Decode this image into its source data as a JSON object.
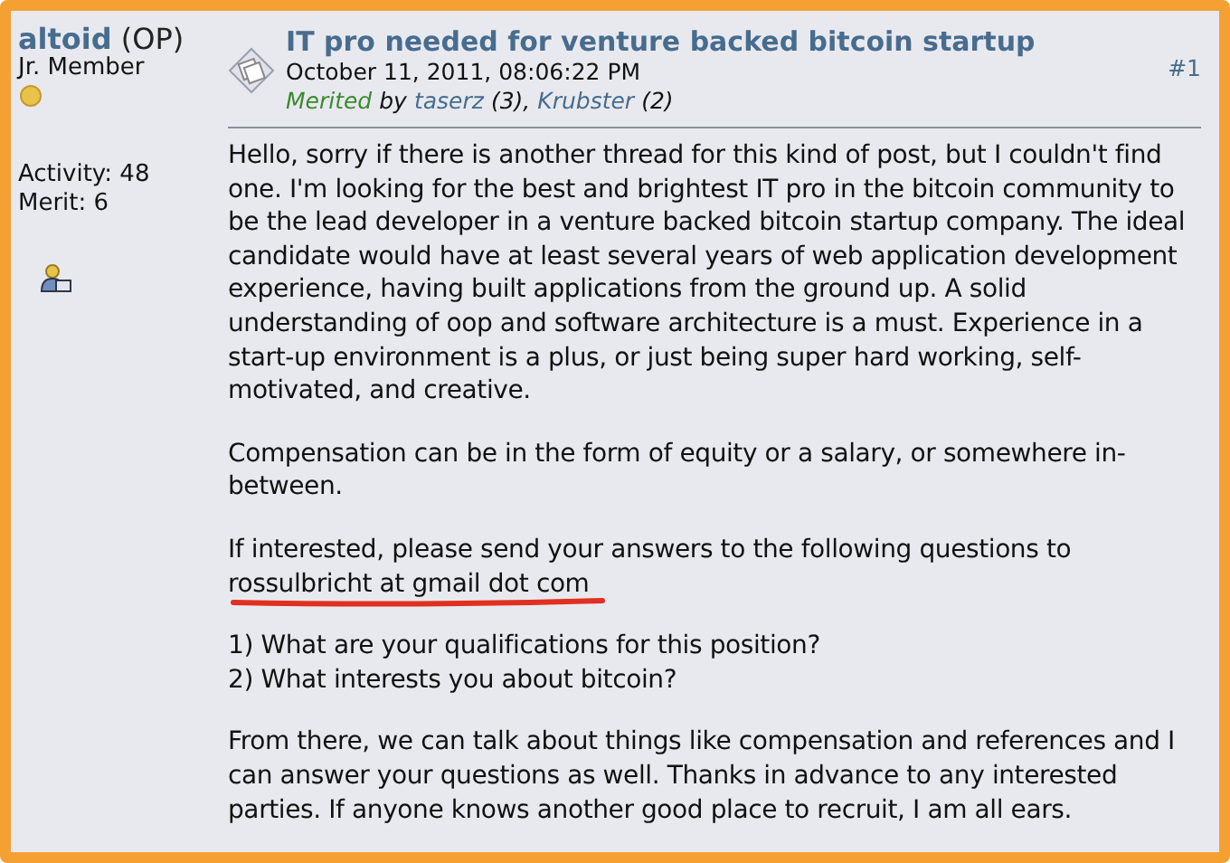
{
  "author": {
    "name": "altoid",
    "tag": "(OP)",
    "rank": "Jr. Member",
    "activity": "Activity: 48",
    "merit": "Merit: 6"
  },
  "post": {
    "title": "IT pro needed for venture backed bitcoin startup",
    "date": "October 11, 2011, 08:06:22 PM",
    "number": "#1",
    "merited": {
      "label": "Merited",
      "by": "by",
      "users": [
        {
          "name": "taserz",
          "count": "(3),"
        },
        {
          "name": "Krubster",
          "count": "(2)"
        }
      ]
    },
    "paragraphs": [
      {
        "kind": "text",
        "text": "Hello, sorry if there is another thread for this kind of post, but I couldn't find one.  I'm looking for the best and brightest IT pro in the bitcoin community to be the lead developer in a venture backed bitcoin startup company.  The ideal candidate would have at least several years of web application development experience, having built applications from the ground up.  A solid understanding of oop and software architecture is a must.  Experience in a start-up environment is a plus, or just being super hard working, self-motivated, and creative."
      },
      {
        "kind": "text",
        "text": "Compensation can be in the form of equity or a salary, or somewhere in-between."
      },
      {
        "kind": "contact",
        "text": "If interested, please send your answers to the following questions to",
        "email": "rossulbricht at gmail dot com"
      },
      {
        "kind": "list",
        "items": [
          "1) What are your qualifications for this position?",
          "2) What interests you about bitcoin?"
        ]
      },
      {
        "kind": "text",
        "text": "From there, we can talk about things like compensation and references and I can answer your questions as well.  Thanks in advance to any interested parties.  If anyone knows another good place to recruit, I am all ears."
      }
    ]
  }
}
